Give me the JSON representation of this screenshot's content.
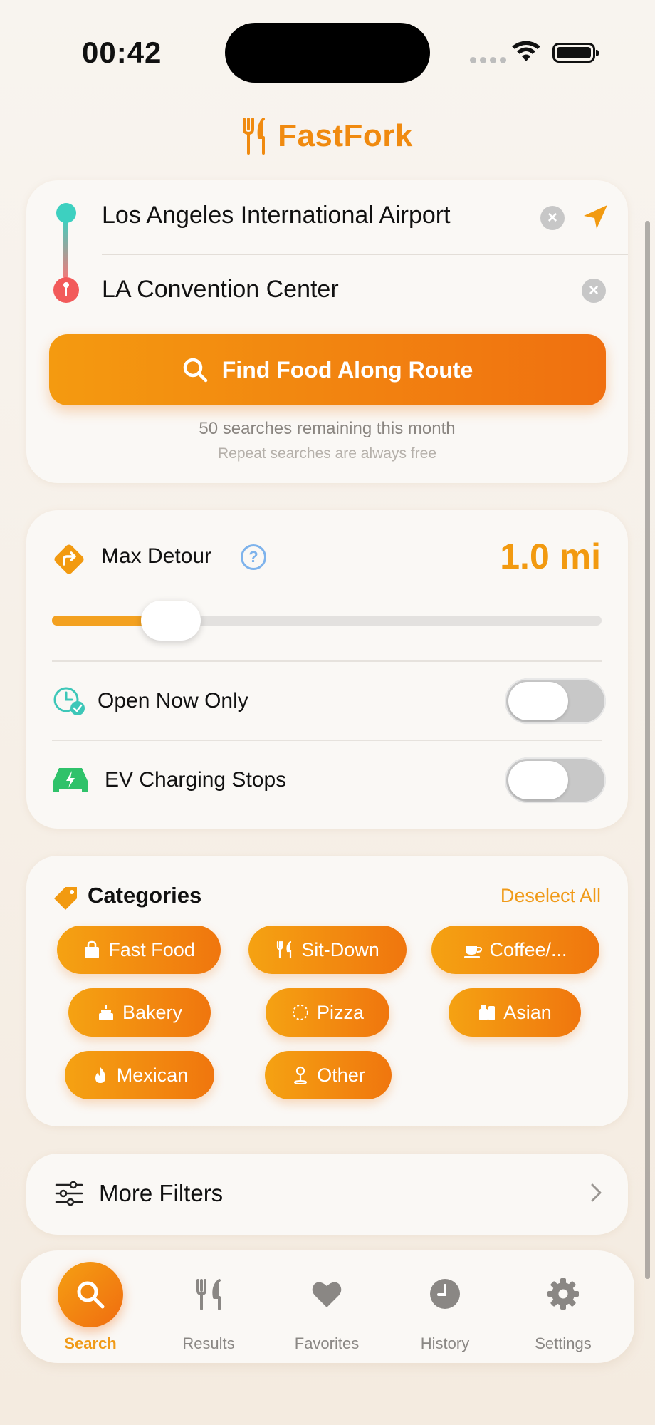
{
  "status_bar": {
    "time": "00:42"
  },
  "header": {
    "app_name": "FastFork"
  },
  "route": {
    "origin": "Los Angeles International Airport",
    "destination": "LA Convention Center",
    "clear_glyph": "×",
    "find_label": "Find Food Along Route",
    "remaining": "50 searches remaining this month",
    "free_note": "Repeat searches are always free"
  },
  "detour": {
    "label": "Max Detour",
    "help_glyph": "?",
    "value": "1.0 mi",
    "slider_fraction": 0.19
  },
  "toggles": [
    {
      "label": "Open Now Only",
      "on": false
    },
    {
      "label": "EV Charging Stops",
      "on": false
    }
  ],
  "categories": {
    "title": "Categories",
    "deselect_label": "Deselect All",
    "items": [
      {
        "label": "Fast Food",
        "icon": "bag-icon"
      },
      {
        "label": "Sit-Down",
        "icon": "fork-knife-icon"
      },
      {
        "label": "Coffee/...",
        "icon": "cup-icon"
      },
      {
        "label": "Bakery",
        "icon": "cake-icon"
      },
      {
        "label": "Pizza",
        "icon": "pizza-icon"
      },
      {
        "label": "Asian",
        "icon": "takeout-icon"
      },
      {
        "label": "Mexican",
        "icon": "flame-icon"
      },
      {
        "label": "Other",
        "icon": "pin-icon"
      }
    ]
  },
  "filters": {
    "label": "More Filters"
  },
  "tabs": [
    {
      "label": "Search",
      "active": true
    },
    {
      "label": "Results",
      "active": false
    },
    {
      "label": "Favorites",
      "active": false
    },
    {
      "label": "History",
      "active": false
    },
    {
      "label": "Settings",
      "active": false
    }
  ],
  "colors": {
    "accent": "#f09a18",
    "accent_dark": "#f06c10",
    "teal": "#3dd0c0",
    "red_pin": "#f25a5a"
  }
}
